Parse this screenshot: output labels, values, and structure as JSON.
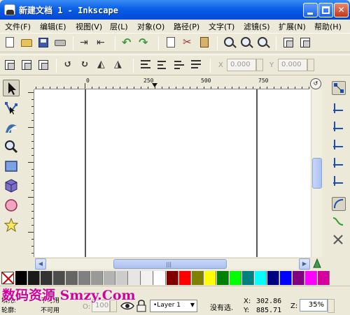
{
  "window": {
    "title": "新建文档 1 - Inkscape"
  },
  "menu": [
    {
      "label": "文件(F)"
    },
    {
      "label": "编辑(E)"
    },
    {
      "label": "视图(V)"
    },
    {
      "label": "层(L)"
    },
    {
      "label": "对象(O)"
    },
    {
      "label": "路径(P)"
    },
    {
      "label": "文字(T)"
    },
    {
      "label": "滤镜(S)"
    },
    {
      "label": "扩展(N)"
    },
    {
      "label": "帮助(H)"
    }
  ],
  "toolbar": {
    "icons": [
      "new-document-icon",
      "open-folder-icon",
      "save-icon",
      "print-icon",
      "import-icon",
      "export-icon",
      "undo-icon",
      "redo-icon",
      "copy-icon",
      "cut-icon",
      "paste-icon",
      "zoom-selection-icon",
      "zoom-drawing-icon",
      "zoom-page-icon",
      "duplicate-icon",
      "clone-icon"
    ]
  },
  "selector_bar": {
    "x_label": "X",
    "x_value": "0.000",
    "y_label": "Y",
    "y_value": "0.000"
  },
  "ruler": {
    "labels": [
      "0",
      "250",
      "500",
      "750"
    ]
  },
  "tools": [
    "selector-tool-icon",
    "node-tool-icon",
    "tweak-tool-icon",
    "zoom-tool-icon",
    "rectangle-tool-icon",
    "3d-box-tool-icon",
    "ellipse-tool-icon",
    "star-tool-icon"
  ],
  "palette": [
    "#000000",
    "#1a1a1a",
    "#333333",
    "#4d4d4d",
    "#666666",
    "#808080",
    "#999999",
    "#b3b3b3",
    "#cccccc",
    "#e6e6e6",
    "#f2f2f2",
    "#ffffff",
    "#800000",
    "#ff0000",
    "#808000",
    "#ffff00",
    "#008000",
    "#00ff00",
    "#008080",
    "#00ffff",
    "#000080",
    "#0000ff",
    "#800080",
    "#ff00ff",
    "#d4009b"
  ],
  "status": {
    "fill_label": "填充:",
    "fill_value": "不可用",
    "stroke_label": "轮廓:",
    "stroke_value": "不可用",
    "opacity_label": "O:",
    "opacity_value": "100",
    "layer": "•Layer 1",
    "message": "没有选.",
    "x_label": "X:",
    "x_value": "302.86",
    "y_label": "Y:",
    "y_value": "885.71",
    "zoom_label": "Z:",
    "zoom_value": "35%"
  },
  "watermark": "数码资源 Smzy.Com"
}
